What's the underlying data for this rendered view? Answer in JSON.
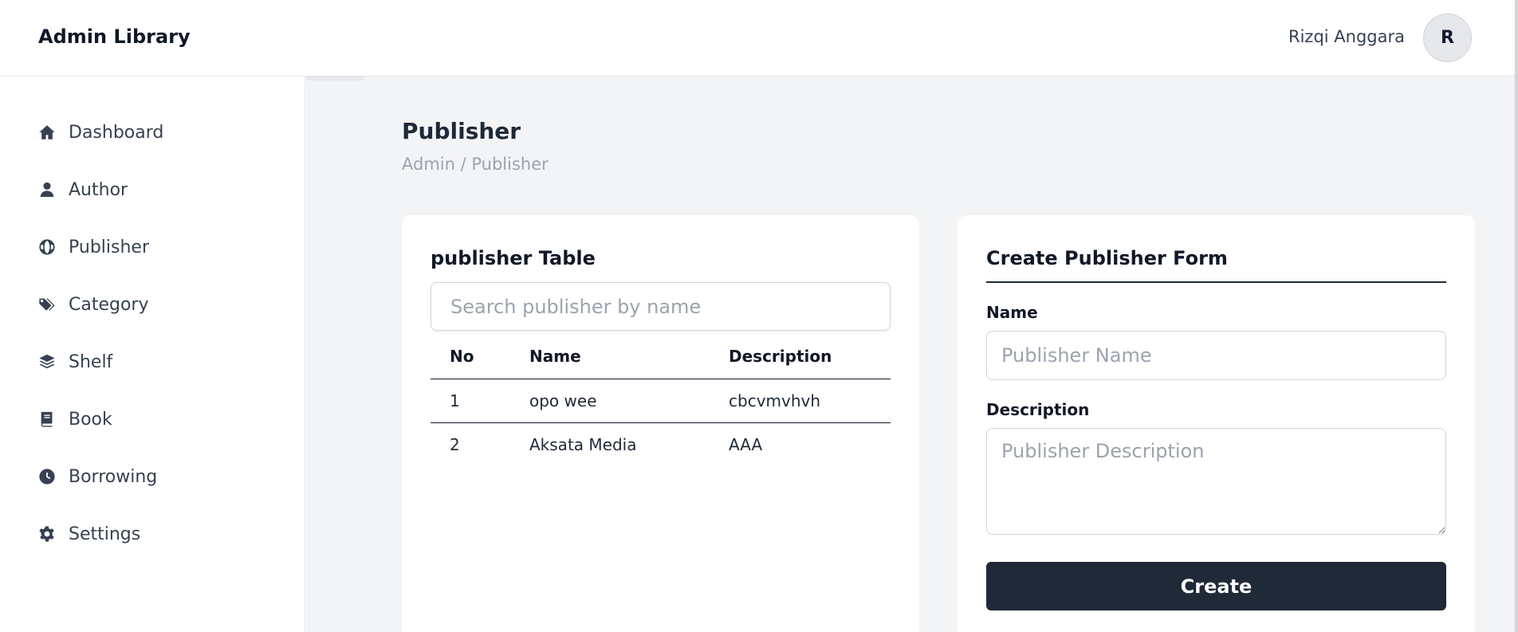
{
  "header": {
    "brand": "Admin Library",
    "user_name": "Rizqi Anggara",
    "avatar_initial": "R"
  },
  "sidebar": {
    "items": [
      {
        "label": "Dashboard",
        "icon": "home-icon"
      },
      {
        "label": "Author",
        "icon": "user-icon"
      },
      {
        "label": "Publisher",
        "icon": "globe-icon"
      },
      {
        "label": "Category",
        "icon": "tags-icon"
      },
      {
        "label": "Shelf",
        "icon": "layers-icon"
      },
      {
        "label": "Book",
        "icon": "book-icon"
      },
      {
        "label": "Borrowing",
        "icon": "clock-icon"
      },
      {
        "label": "Settings",
        "icon": "gear-icon"
      }
    ]
  },
  "page": {
    "title": "Publisher",
    "breadcrumb": "Admin / Publisher"
  },
  "table_card": {
    "title": "publisher Table",
    "search_placeholder": "Search publisher by name",
    "columns": [
      "No",
      "Name",
      "Description"
    ],
    "rows": [
      {
        "no": "1",
        "name": "opo wee",
        "description": "cbcvmvhvh"
      },
      {
        "no": "2",
        "name": "Aksata Media",
        "description": "AAA"
      }
    ]
  },
  "form_card": {
    "title": "Create Publisher Form",
    "name_label": "Name",
    "name_placeholder": "Publisher Name",
    "description_label": "Description",
    "description_placeholder": "Publisher Description",
    "submit_label": "Create"
  },
  "colors": {
    "primary_dark": "#1f2937",
    "main_bg": "#f3f4f6",
    "muted_text": "#9ca3af"
  }
}
